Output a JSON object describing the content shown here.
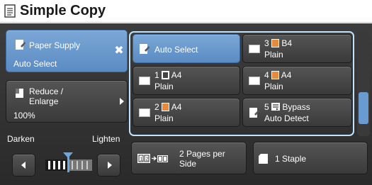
{
  "title": "Simple Copy",
  "paper_supply": {
    "label": "Paper Supply",
    "value": "Auto Select"
  },
  "reduce_enlarge": {
    "label_line1": "Reduce /",
    "label_line2": "Enlarge",
    "value": "100%"
  },
  "density": {
    "darken_label": "Darken",
    "lighten_label": "Lighten"
  },
  "trays": [
    {
      "label": "Auto Select"
    },
    {
      "number": "3",
      "size": "B4",
      "type": "Plain"
    },
    {
      "number": "1",
      "size": "A4",
      "type": "Plain"
    },
    {
      "number": "4",
      "size": "A4",
      "type": "Plain"
    },
    {
      "number": "2",
      "size": "A4",
      "type": "Plain"
    },
    {
      "number": "5",
      "size": "Bypass",
      "type": "Auto Detect"
    }
  ],
  "duplex": {
    "label_line1": "2 Pages per",
    "label_line2": "Side",
    "icon_left": "1 2",
    "icon_right": "1 2"
  },
  "staple": {
    "label": "1 Staple"
  },
  "colors": {
    "accent_blue": "#6a9bd0",
    "selected_border": "#bfe3ff",
    "paper_orange": "#e9893b"
  }
}
